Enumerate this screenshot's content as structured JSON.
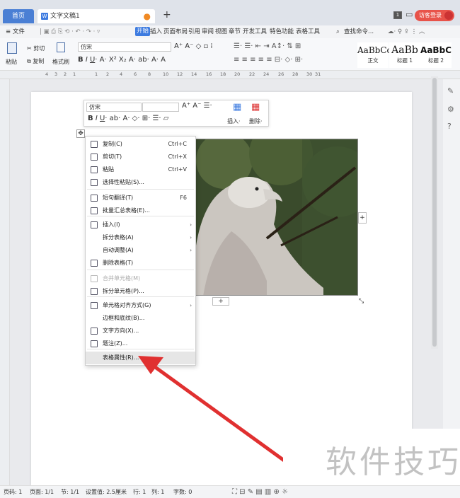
{
  "tabs": {
    "home": "首页",
    "doc": "文字文稿1",
    "new": "+"
  },
  "titlebar": {
    "badge": "1",
    "visitor": "访客登录"
  },
  "menubar": {
    "file": "≡ 文件",
    "items": [
      "开始",
      "插入",
      "页面布局",
      "引用",
      "审阅",
      "视图",
      "章节",
      "开发工具",
      "特色功能",
      "表格工具"
    ],
    "search": "查找命令..."
  },
  "ribbon": {
    "paste": "粘贴",
    "cut": "剪切",
    "copy": "复制",
    "format_painter": "格式刷",
    "font": "仿宋",
    "styles": [
      {
        "sample": "AaBbCc",
        "name": "正文"
      },
      {
        "sample": "AaBb",
        "name": "标题 1"
      },
      {
        "sample": "AaBbC",
        "name": "标题 2"
      }
    ]
  },
  "ruler": {
    "ticks": [
      "4",
      "3",
      "2",
      "1",
      "1",
      "2",
      "4",
      "6",
      "8",
      "10",
      "12",
      "14",
      "16",
      "18",
      "20",
      "22",
      "24",
      "26",
      "28",
      "30",
      "31"
    ]
  },
  "minitoolbar": {
    "font": "仿宋",
    "insert": "插入·",
    "delete": "删除·"
  },
  "context_menu": {
    "items": [
      {
        "label": "复制(C)",
        "shortcut": "Ctrl+C"
      },
      {
        "label": "剪切(T)",
        "shortcut": "Ctrl+X"
      },
      {
        "label": "粘贴",
        "shortcut": "Ctrl+V"
      },
      {
        "label": "选择性粘贴(S)...",
        "shortcut": ""
      },
      {
        "label": "短句翻译(T)",
        "shortcut": "F6"
      },
      {
        "label": "批量汇总表格(E)...",
        "shortcut": ""
      },
      {
        "label": "插入(I)",
        "shortcut": ""
      },
      {
        "label": "拆分表格(A)",
        "shortcut": ""
      },
      {
        "label": "自动调整(A)",
        "shortcut": ""
      },
      {
        "label": "删除表格(T)",
        "shortcut": ""
      },
      {
        "label": "合并单元格(M)",
        "shortcut": ""
      },
      {
        "label": "拆分单元格(P)...",
        "shortcut": ""
      },
      {
        "label": "单元格对齐方式(G)",
        "shortcut": ""
      },
      {
        "label": "边框和底纹(B)...",
        "shortcut": ""
      },
      {
        "label": "文字方向(X)...",
        "shortcut": ""
      },
      {
        "label": "题注(Z)...",
        "shortcut": ""
      },
      {
        "label": "表格属性(R)...",
        "shortcut": ""
      }
    ]
  },
  "status": {
    "page_no": "页码: 1",
    "pages": "页面: 1/1",
    "section": "节: 1/1",
    "setting": "设置值: 2.5厘米",
    "row": "行: 1",
    "col": "列: 1",
    "words": "字数: 0"
  },
  "watermark": "软件技巧",
  "colors": {
    "accent": "#3d7be0",
    "arrow": "#e03030",
    "visitor": "#e8534a"
  }
}
